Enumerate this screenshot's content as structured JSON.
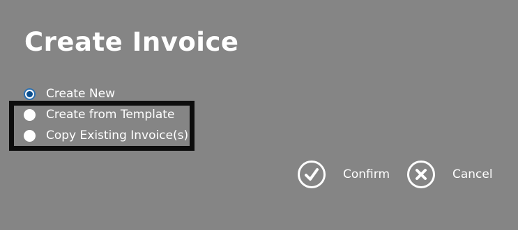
{
  "dialog": {
    "title": "Create Invoice",
    "options": [
      {
        "label": "Create New",
        "selected": true
      },
      {
        "label": "Create from Template",
        "selected": false
      },
      {
        "label": "Copy Existing Invoice(s)",
        "selected": false
      }
    ],
    "confirm_label": "Confirm",
    "cancel_label": "Cancel",
    "confirm_icon": "check-circle-icon",
    "cancel_icon": "close-circle-icon"
  },
  "colors": {
    "background": "#858585",
    "text": "#ffffff",
    "radio_selected": "#0b4f8f",
    "highlight_border": "#0d0d0d"
  }
}
